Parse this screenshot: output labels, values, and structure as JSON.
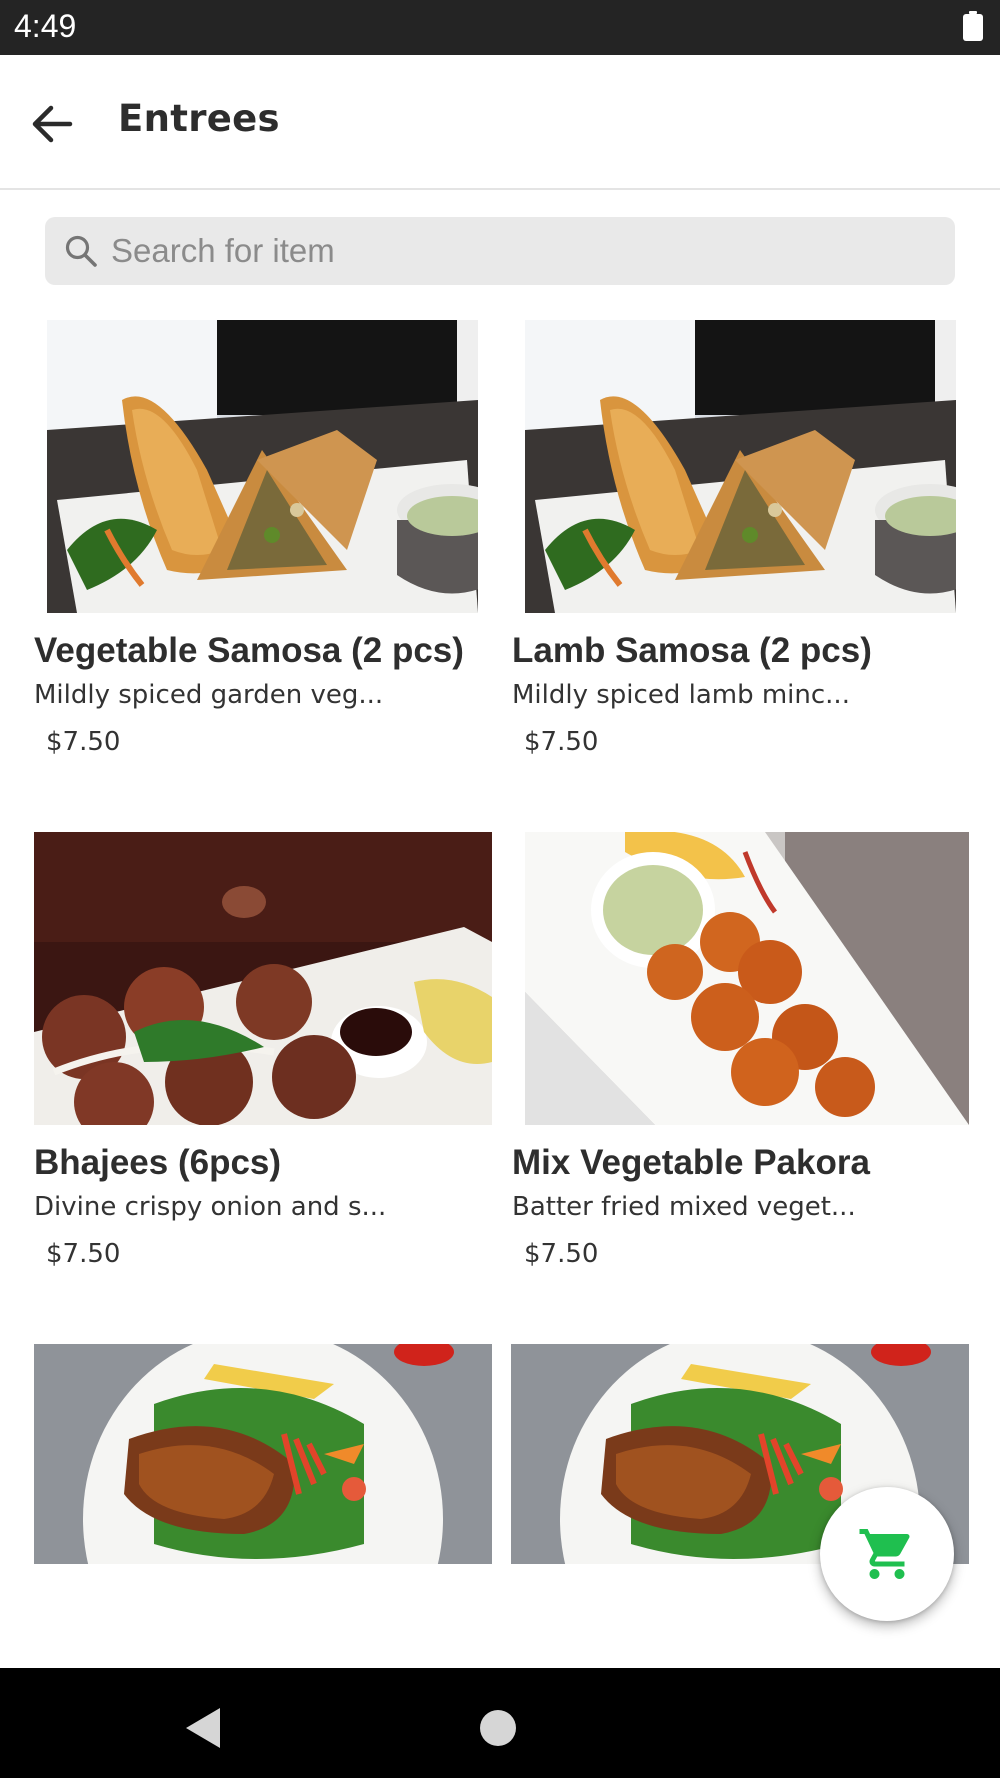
{
  "status_bar": {
    "time": "4:49",
    "icons": [
      "battery-icon"
    ]
  },
  "header": {
    "title": "Entrees",
    "back_icon": "arrow-left-icon"
  },
  "search": {
    "placeholder": "Search for item",
    "value": "",
    "icon": "search-icon"
  },
  "items": [
    {
      "name": "Vegetable Samosa (2 pcs)",
      "description": "Mildly spiced garden veg...",
      "price": "$7.50",
      "image": "samosa-plate"
    },
    {
      "name": "Lamb Samosa (2 pcs)",
      "description": "Mildly spiced lamb minc...",
      "price": "$7.50",
      "image": "samosa-plate"
    },
    {
      "name": "Bhajees (6pcs)",
      "description": "Divine crispy onion and s...",
      "price": "$7.50",
      "image": "onion-bhajee-plate"
    },
    {
      "name": "Mix Vegetable Pakora",
      "description": "Batter fried mixed veget...",
      "price": "$7.50",
      "image": "pakora-plate"
    },
    {
      "image": "grilled-fish-salad-plate"
    },
    {
      "image": "grilled-fish-salad-plate"
    }
  ],
  "cart_button": {
    "icon": "shopping-cart-icon",
    "color": "#1fbf4f"
  },
  "nav_bar": {
    "icons": [
      "nav-back-icon",
      "nav-home-icon"
    ]
  }
}
